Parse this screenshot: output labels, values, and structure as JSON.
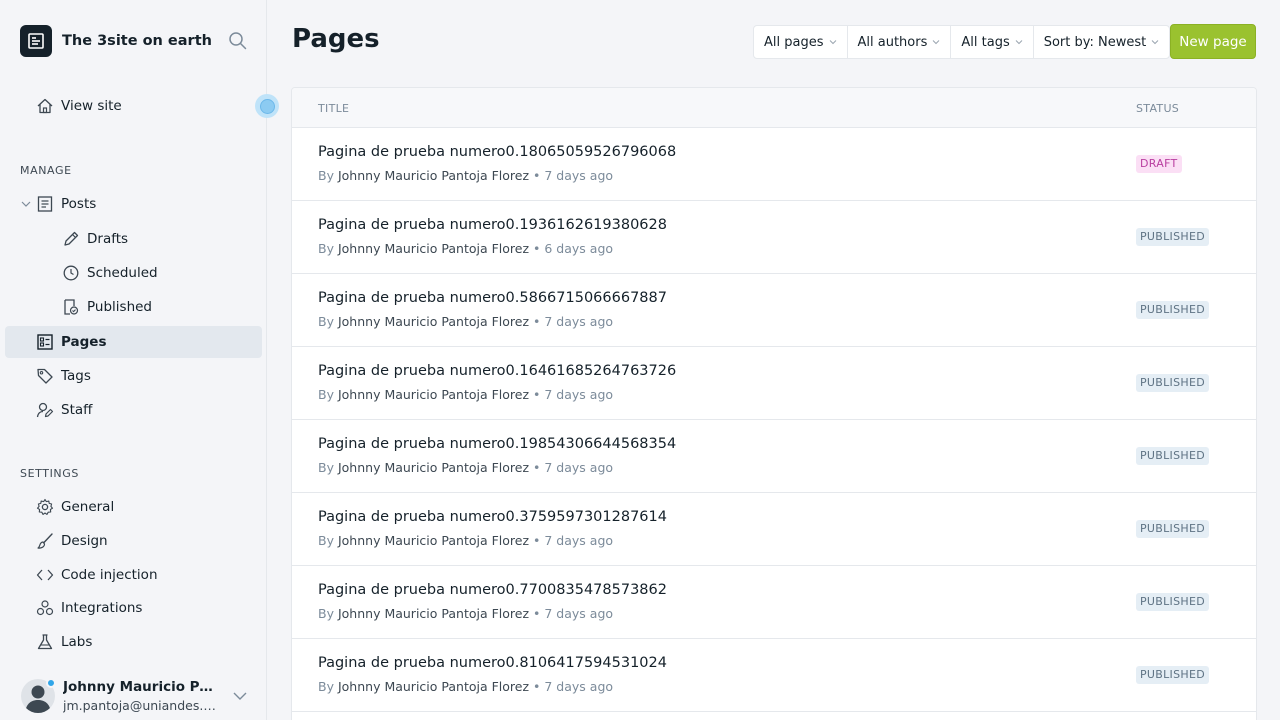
{
  "site": {
    "title": "The 3site on earth"
  },
  "nav": {
    "view_site": "View site",
    "manage_label": "MANAGE",
    "posts": "Posts",
    "drafts": "Drafts",
    "scheduled": "Scheduled",
    "published": "Published",
    "pages": "Pages",
    "tags": "Tags",
    "staff": "Staff",
    "settings_label": "SETTINGS",
    "general": "General",
    "design": "Design",
    "code_injection": "Code injection",
    "integrations": "Integrations",
    "labs": "Labs"
  },
  "user": {
    "name": "Johnny Mauricio Pantoja Florez",
    "email": "jm.pantoja@uniandes.edu.co"
  },
  "header": {
    "title": "Pages",
    "filters": [
      "All pages",
      "All authors",
      "All tags",
      "Sort by: Newest"
    ],
    "new_page": "New page"
  },
  "table": {
    "col_title": "TITLE",
    "col_status": "STATUS",
    "rows": [
      {
        "title": "Pagina de prueba numero0.18065059526796068",
        "by": "By",
        "author": "Johnny Mauricio Pantoja Florez",
        "sep": "•",
        "time": "7 days ago",
        "status": "DRAFT",
        "kind": "draft"
      },
      {
        "title": "Pagina de prueba numero0.1936162619380628",
        "by": "By",
        "author": "Johnny Mauricio Pantoja Florez",
        "sep": "•",
        "time": "6 days ago",
        "status": "PUBLISHED",
        "kind": "published"
      },
      {
        "title": "Pagina de prueba numero0.5866715066667887",
        "by": "By",
        "author": "Johnny Mauricio Pantoja Florez",
        "sep": "•",
        "time": "7 days ago",
        "status": "PUBLISHED",
        "kind": "published"
      },
      {
        "title": "Pagina de prueba numero0.16461685264763726",
        "by": "By",
        "author": "Johnny Mauricio Pantoja Florez",
        "sep": "•",
        "time": "7 days ago",
        "status": "PUBLISHED",
        "kind": "published"
      },
      {
        "title": "Pagina de prueba numero0.19854306644568354",
        "by": "By",
        "author": "Johnny Mauricio Pantoja Florez",
        "sep": "•",
        "time": "7 days ago",
        "status": "PUBLISHED",
        "kind": "published"
      },
      {
        "title": "Pagina de prueba numero0.3759597301287614",
        "by": "By",
        "author": "Johnny Mauricio Pantoja Florez",
        "sep": "•",
        "time": "7 days ago",
        "status": "PUBLISHED",
        "kind": "published"
      },
      {
        "title": "Pagina de prueba numero0.7700835478573862",
        "by": "By",
        "author": "Johnny Mauricio Pantoja Florez",
        "sep": "•",
        "time": "7 days ago",
        "status": "PUBLISHED",
        "kind": "published"
      },
      {
        "title": "Pagina de prueba numero0.8106417594531024",
        "by": "By",
        "author": "Johnny Mauricio Pantoja Florez",
        "sep": "•",
        "time": "7 days ago",
        "status": "PUBLISHED",
        "kind": "published"
      }
    ]
  },
  "colors": {
    "accent": "#9ac22f",
    "draft": "#b93ea0",
    "published": "#5f7384",
    "text": "#15212a"
  }
}
